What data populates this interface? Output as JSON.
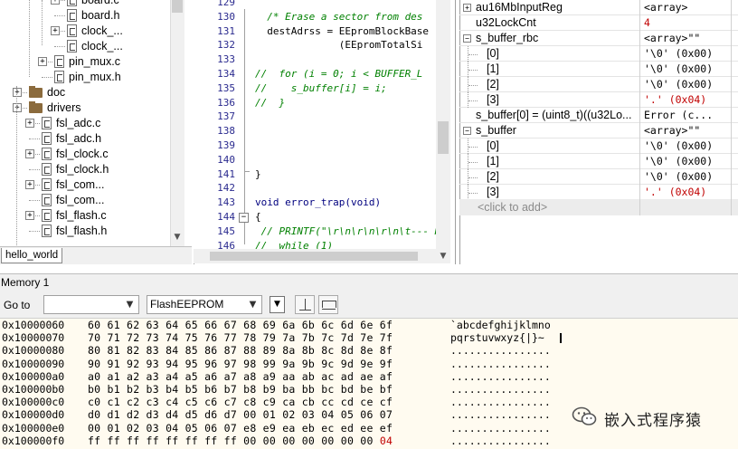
{
  "tree": {
    "items": [
      {
        "label": "board.c",
        "kind": "file",
        "indent": 4,
        "expander": true
      },
      {
        "label": "board.h",
        "kind": "file",
        "indent": 4,
        "expander": false
      },
      {
        "label": "clock_...",
        "kind": "file",
        "indent": 4,
        "expander": true
      },
      {
        "label": "clock_...",
        "kind": "file",
        "indent": 4,
        "expander": false
      },
      {
        "label": "pin_mux.c",
        "kind": "file",
        "indent": 3,
        "expander": true
      },
      {
        "label": "pin_mux.h",
        "kind": "file",
        "indent": 3,
        "expander": false
      },
      {
        "label": "doc",
        "kind": "folder",
        "indent": 1,
        "expander": true
      },
      {
        "label": "drivers",
        "kind": "folder",
        "indent": 1,
        "expander": true
      },
      {
        "label": "fsl_adc.c",
        "kind": "file",
        "indent": 2,
        "expander": true
      },
      {
        "label": "fsl_adc.h",
        "kind": "file",
        "indent": 2,
        "expander": false
      },
      {
        "label": "fsl_clock.c",
        "kind": "file",
        "indent": 2,
        "expander": true
      },
      {
        "label": "fsl_clock.h",
        "kind": "file",
        "indent": 2,
        "expander": false
      },
      {
        "label": "fsl_com...",
        "kind": "file",
        "indent": 2,
        "expander": true
      },
      {
        "label": "fsl_com...",
        "kind": "file",
        "indent": 2,
        "expander": false
      },
      {
        "label": "fsl_flash.c",
        "kind": "file",
        "indent": 2,
        "expander": true
      },
      {
        "label": "fsl_flash.h",
        "kind": "file",
        "indent": 2,
        "expander": false
      }
    ],
    "tab_label": "hello_world"
  },
  "editor": {
    "lines": [
      {
        "num": "129",
        "text": "",
        "cls": ""
      },
      {
        "num": "130",
        "text": "  /* Erase a sector from des",
        "cls": "comment"
      },
      {
        "num": "131",
        "text": "  destAdrss = EEpromBlockBase",
        "cls": ""
      },
      {
        "num": "132",
        "text": "              (EEpromTotalSi",
        "cls": ""
      },
      {
        "num": "133",
        "text": "",
        "cls": ""
      },
      {
        "num": "134",
        "text": "//  for (i = 0; i < BUFFER_L",
        "cls": "comment"
      },
      {
        "num": "135",
        "text": "//    s_buffer[i] = i;",
        "cls": "comment"
      },
      {
        "num": "136",
        "text": "//  }",
        "cls": "comment"
      },
      {
        "num": "137",
        "text": "",
        "cls": ""
      },
      {
        "num": "138",
        "text": "",
        "cls": ""
      },
      {
        "num": "139",
        "text": "",
        "cls": ""
      },
      {
        "num": "140",
        "text": "",
        "cls": ""
      },
      {
        "num": "141",
        "text": "}",
        "cls": ""
      },
      {
        "num": "142",
        "text": "",
        "cls": ""
      },
      {
        "num": "143",
        "text": "void error_trap(void)",
        "cls": "kw"
      },
      {
        "num": "144",
        "text": "{",
        "cls": ""
      },
      {
        "num": "145",
        "text": " // PRINTF(\"\\r\\n\\r\\n\\r\\n\\t--- H",
        "cls": "comment"
      },
      {
        "num": "146",
        "text": "//  while (1)",
        "cls": "comment"
      }
    ],
    "fold_glyph": "−"
  },
  "watch": {
    "rows": [
      {
        "name": "au16MbInputReg",
        "value": "<array>",
        "indent": 0,
        "expander": "+",
        "red": false
      },
      {
        "name": "u32LockCnt",
        "value": "4",
        "indent": 0,
        "expander": "",
        "red": true
      },
      {
        "name": "s_buffer_rbc",
        "value": "<array>\"\"",
        "indent": 0,
        "expander": "−",
        "red": false
      },
      {
        "name": "[0]",
        "value": "'\\0' (0x00)",
        "indent": 1,
        "expander": "",
        "red": false
      },
      {
        "name": "[1]",
        "value": "'\\0' (0x00)",
        "indent": 1,
        "expander": "",
        "red": false
      },
      {
        "name": "[2]",
        "value": "'\\0' (0x00)",
        "indent": 1,
        "expander": "",
        "red": false
      },
      {
        "name": "[3]",
        "value": "'.' (0x04)",
        "indent": 1,
        "expander": "",
        "red": true
      },
      {
        "name": "s_buffer[0] = (uint8_t)((u32Lo...",
        "value": "Error (c...",
        "indent": 0,
        "expander": "",
        "red": false
      },
      {
        "name": "s_buffer",
        "value": "<array>\"\"",
        "indent": 0,
        "expander": "−",
        "red": false
      },
      {
        "name": "[0]",
        "value": "'\\0' (0x00)",
        "indent": 1,
        "expander": "",
        "red": false
      },
      {
        "name": "[1]",
        "value": "'\\0' (0x00)",
        "indent": 1,
        "expander": "",
        "red": false
      },
      {
        "name": "[2]",
        "value": "'\\0' (0x00)",
        "indent": 1,
        "expander": "",
        "red": false
      },
      {
        "name": "[3]",
        "value": "'.' (0x04)",
        "indent": 1,
        "expander": "",
        "red": true
      }
    ],
    "add_placeholder": "<click to add>"
  },
  "memory": {
    "title": "Memory 1",
    "goto_label": "Go to",
    "goto_value": "",
    "zone": "FlashEEPROM",
    "rows": [
      {
        "addr": "0x10000060",
        "bytes": "60 61 62 63 64 65 66 67 68 69 6a 6b 6c 6d 6e 6f",
        "red_tail": "",
        "ascii": "`abcdefghijklmno"
      },
      {
        "addr": "0x10000070",
        "bytes": "70 71 72 73 74 75 76 77 78 79 7a 7b 7c 7d 7e 7f",
        "red_tail": "",
        "ascii": "pqrstuvwxyz{|}~"
      },
      {
        "addr": "0x10000080",
        "bytes": "80 81 82 83 84 85 86 87 88 89 8a 8b 8c 8d 8e 8f",
        "red_tail": "",
        "ascii": "................"
      },
      {
        "addr": "0x10000090",
        "bytes": "90 91 92 93 94 95 96 97 98 99 9a 9b 9c 9d 9e 9f",
        "red_tail": "",
        "ascii": "................"
      },
      {
        "addr": "0x100000a0",
        "bytes": "a0 a1 a2 a3 a4 a5 a6 a7 a8 a9 aa ab ac ad ae af",
        "red_tail": "",
        "ascii": "................"
      },
      {
        "addr": "0x100000b0",
        "bytes": "b0 b1 b2 b3 b4 b5 b6 b7 b8 b9 ba bb bc bd be bf",
        "red_tail": "",
        "ascii": "................"
      },
      {
        "addr": "0x100000c0",
        "bytes": "c0 c1 c2 c3 c4 c5 c6 c7 c8 c9 ca cb cc cd ce cf",
        "red_tail": "",
        "ascii": "................"
      },
      {
        "addr": "0x100000d0",
        "bytes": "d0 d1 d2 d3 d4 d5 d6 d7 00 01 02 03 04 05 06 07",
        "red_tail": "",
        "ascii": "................"
      },
      {
        "addr": "0x100000e0",
        "bytes": "00 01 02 03 04 05 06 07 e8 e9 ea eb ec ed ee ef",
        "red_tail": "",
        "ascii": "................"
      },
      {
        "addr": "0x100000f0",
        "bytes": "ff ff ff ff ff ff ff ff 00 00 00 00 00 00 00 ",
        "red_tail": "04",
        "ascii": "................"
      }
    ]
  },
  "watermark": {
    "text": "嵌入式程序猿",
    "icon": "wechat-icon"
  }
}
